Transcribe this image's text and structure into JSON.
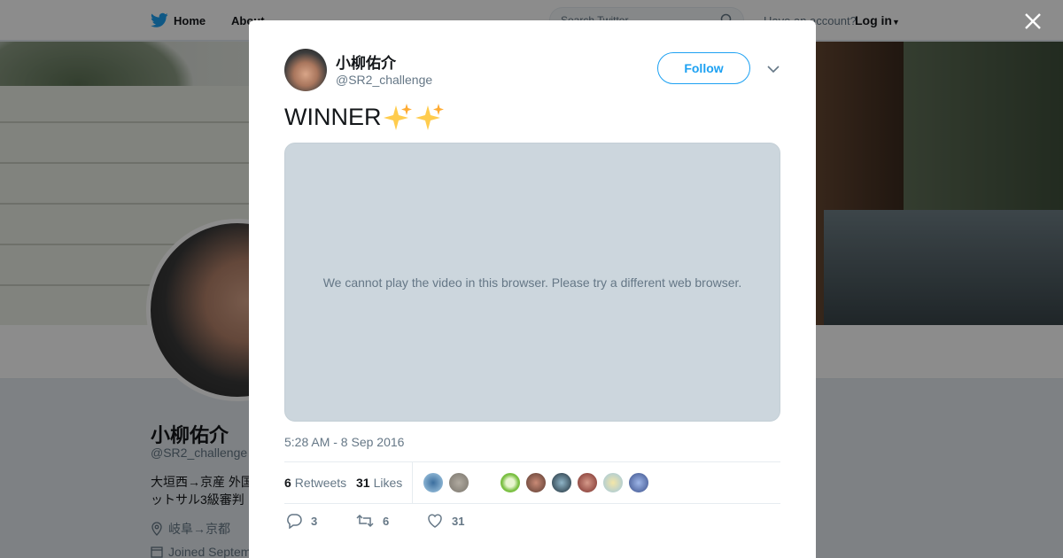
{
  "nav": {
    "home_label": "Home",
    "about_label": "About",
    "search_placeholder": "Search Twitter",
    "account_prompt": "Have an account?",
    "login_label": "Log in"
  },
  "profile": {
    "name": "小柳佑介",
    "handle": "@SR2_challenge",
    "bio": "大垣西→京産 外国 フットサル3級審判",
    "location": "岐阜→京都",
    "joined": "Joined Septem"
  },
  "tweet": {
    "author_name": "小柳佑介",
    "author_handle": "@SR2_challenge",
    "follow_label": "Follow",
    "text": "WINNER",
    "video_message": "We cannot play the video in this browser. Please try a different web browser.",
    "timestamp": "5:28 AM - 8 Sep 2016",
    "retweets_count": "6",
    "retweets_label": "Retweets",
    "likes_count": "31",
    "likes_label": "Likes",
    "reply_count": "3",
    "retweet_action_count": "6",
    "like_action_count": "31"
  },
  "colors": {
    "accent": "#1da1f2",
    "muted": "#657786",
    "video_bg": "#ccd6dd"
  },
  "icons": {
    "twitter_bird": "twitter-bird-icon",
    "search": "search-icon",
    "close": "close-icon",
    "caret": "chevron-down-icon",
    "reply": "reply-icon",
    "retweet": "retweet-icon",
    "like": "heart-icon",
    "location": "location-pin-icon",
    "calendar": "calendar-icon"
  }
}
